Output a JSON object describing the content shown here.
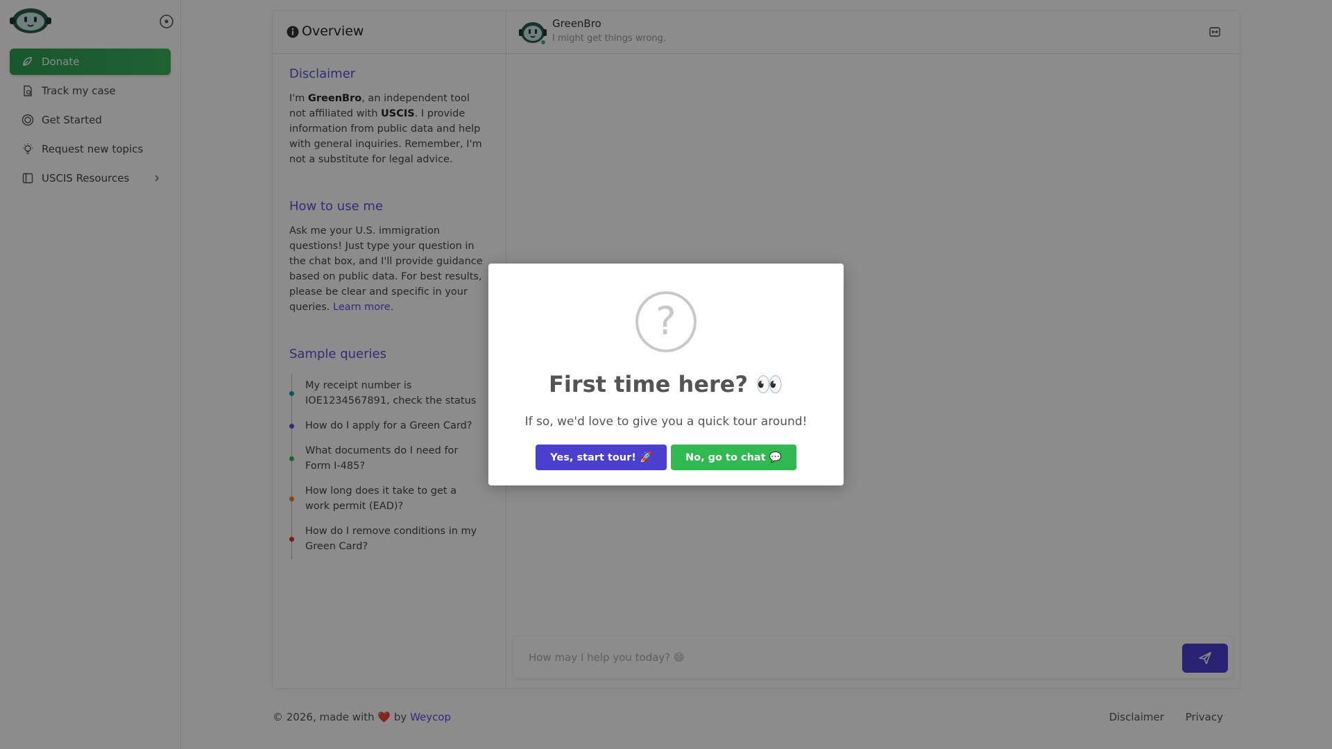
{
  "sidebar": {
    "items": [
      {
        "label": "Donate",
        "icon": "donate-icon"
      },
      {
        "label": "Track my case",
        "icon": "document-search-icon"
      },
      {
        "label": "Get Started",
        "icon": "target-icon"
      },
      {
        "label": "Request new topics",
        "icon": "lightbulb-icon"
      },
      {
        "label": "USCIS Resources",
        "icon": "book-icon"
      }
    ]
  },
  "overview": {
    "title": "Overview",
    "disclaimer_title": "Disclaimer",
    "disclaimer_pre": "I'm ",
    "disclaimer_brand": "GreenBro",
    "disclaimer_mid": ", an independent tool not affiliated with ",
    "disclaimer_org": "USCIS",
    "disclaimer_post": ". I provide information from public data and help with general inquiries. Remember, I'm not a substitute for legal advice.",
    "howto_title": "How to use me",
    "howto_text": "Ask me your U.S. immigration questions! Just type your question in the chat box, and I'll provide guidance based on public data. For best results, please be clear and specific in your queries. ",
    "howto_link": "Learn more.",
    "samples_title": "Sample queries",
    "samples": [
      {
        "text": "My receipt number is IOE1234567891, check the status",
        "color": "#1a9bb0"
      },
      {
        "text": "How do I apply for a Green Card?",
        "color": "#5b4fd8"
      },
      {
        "text": "What documents do I need for Form I-485?",
        "color": "#2fb94f"
      },
      {
        "text": "How long does it take to get a work permit (EAD)?",
        "color": "#e08a1e"
      },
      {
        "text": "How do I remove conditions in my Green Card?",
        "color": "#d9342b"
      }
    ]
  },
  "chat": {
    "bot_name": "GreenBro",
    "bot_sub": "I might get things wrong.",
    "input_placeholder": "How may I help you today? 😄"
  },
  "footer": {
    "prefix": "© 2026, made with",
    "heart": "❤️",
    "by": "by",
    "link": "Weycop",
    "disclaimer": "Disclaimer",
    "privacy": "Privacy"
  },
  "modal": {
    "icon_glyph": "?",
    "title": "First time here? 👀",
    "text": "If so, we'd love to give you a quick tour around!",
    "yes_label": "Yes, start tour! 🚀",
    "no_label": "No, go to chat 💬"
  },
  "colors": {
    "accent": "#4b3fd0",
    "green": "#2fb94f",
    "link": "#5b4fd8"
  }
}
